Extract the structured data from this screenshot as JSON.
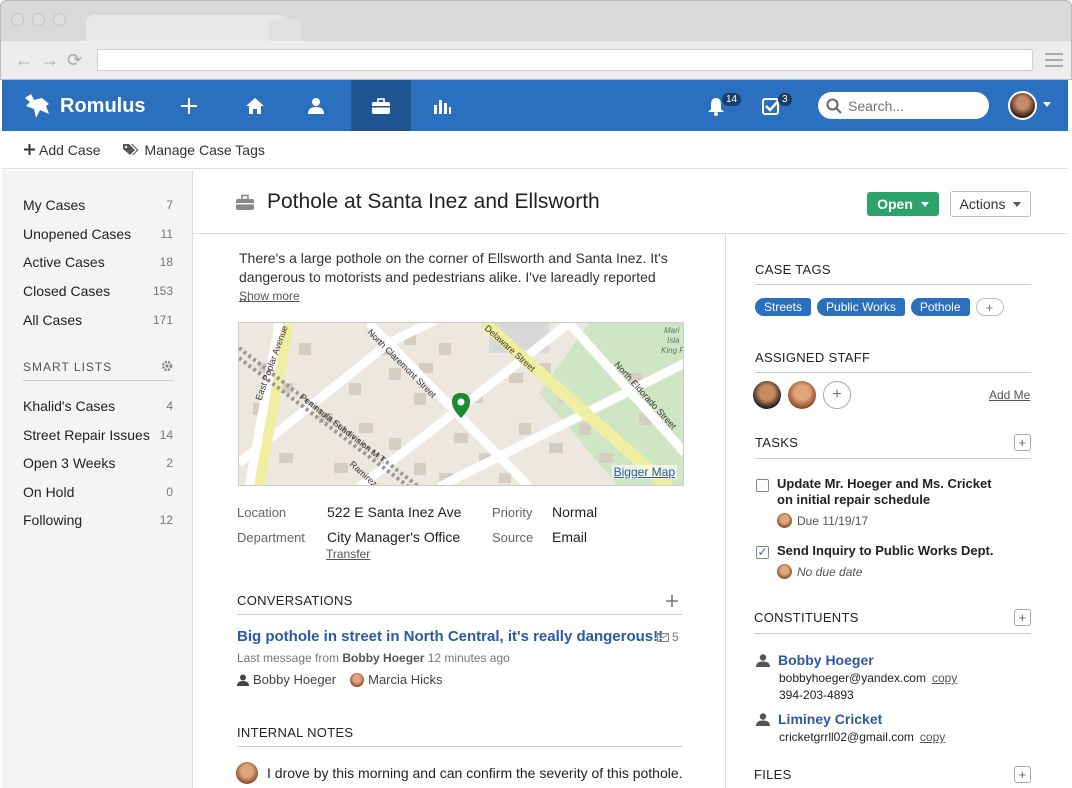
{
  "app": {
    "name": "Romulus"
  },
  "header": {
    "notifications_count": "14",
    "tasks_count": "3",
    "search_placeholder": "Search..."
  },
  "subbar": {
    "add_case": "Add Case",
    "manage_tags": "Manage Case Tags"
  },
  "sidebar": {
    "items": [
      {
        "label": "My Cases",
        "count": "7"
      },
      {
        "label": "Unopened Cases",
        "count": "11"
      },
      {
        "label": "Active Cases",
        "count": "18"
      },
      {
        "label": "Closed Cases",
        "count": "153"
      },
      {
        "label": "All Cases",
        "count": "171"
      }
    ],
    "smart_lists_title": "SMART LISTS",
    "smart_lists": [
      {
        "label": "Khalid's Cases",
        "count": "4"
      },
      {
        "label": "Street Repair Issues",
        "count": "14"
      },
      {
        "label": "Open 3 Weeks",
        "count": "2"
      },
      {
        "label": "On Hold",
        "count": "0"
      },
      {
        "label": "Following",
        "count": "12"
      }
    ]
  },
  "case": {
    "title": "Pothole at Santa Inez and Ellsworth",
    "status": "Open",
    "actions_label": "Actions",
    "description": "There's a large pothole on the corner of Ellsworth and Santa Inez.  It's dangerous to motorists and pedestrians alike. I've lareadly reported ...",
    "show_more": "Show more",
    "map": {
      "link": "Bigger Map",
      "streets": [
        "East Poplar Avenue",
        "North Claremont Street",
        "Delaware Street",
        "North Eldorado Street",
        "Peninsula Subdivision M.T.",
        "Ramirez"
      ],
      "corner_text": [
        "Mari",
        "Isla",
        "King F"
      ]
    },
    "fields": {
      "location_label": "Location",
      "location": "522 E Santa Inez Ave",
      "department_label": "Department",
      "department": "City Manager's Office",
      "transfer": "Transfer",
      "priority_label": "Priority",
      "priority": "Normal",
      "source_label": "Source",
      "source": "Email"
    }
  },
  "conversations": {
    "title": "CONVERSATIONS",
    "items": [
      {
        "subject": "Big pothole in street in North Central, it's really dangerous!!",
        "count": "5",
        "meta_prefix": "Last message from",
        "meta_author": "Bobby Hoeger",
        "meta_time": "12 minutes ago",
        "participants": [
          "Bobby Hoeger",
          "Marcia Hicks"
        ]
      }
    ]
  },
  "internal_notes": {
    "title": "INTERNAL NOTES",
    "first_note": "I drove by this morning and can confirm the severity of this pothole."
  },
  "right": {
    "case_tags_title": "CASE TAGS",
    "tags": [
      "Streets",
      "Public Works",
      "Pothole"
    ],
    "assigned_staff_title": "ASSIGNED STAFF",
    "add_me": "Add Me",
    "tasks_title": "TASKS",
    "tasks": [
      {
        "title": "Update Mr. Hoeger and Ms. Cricket on initial repair schedule",
        "due": "Due 11/19/17",
        "done": false
      },
      {
        "title": "Send Inquiry to Public Works Dept.",
        "due": "No due date",
        "done": true
      }
    ],
    "constituents_title": "CONSTITUENTS",
    "constituents": [
      {
        "name": "Bobby Hoeger",
        "email": "bobbyhoeger@yandex.com",
        "phone": "394-203-4893"
      },
      {
        "name": "Liminey Cricket",
        "email": "cricketgrrll02@gmail.com",
        "phone": ""
      }
    ],
    "copy_label": "copy",
    "files_title": "FILES"
  },
  "colors": {
    "header": "#2b6fbf",
    "open_button": "#2ba36b",
    "tag": "#2b6fbf",
    "link": "#2b5aa3"
  }
}
